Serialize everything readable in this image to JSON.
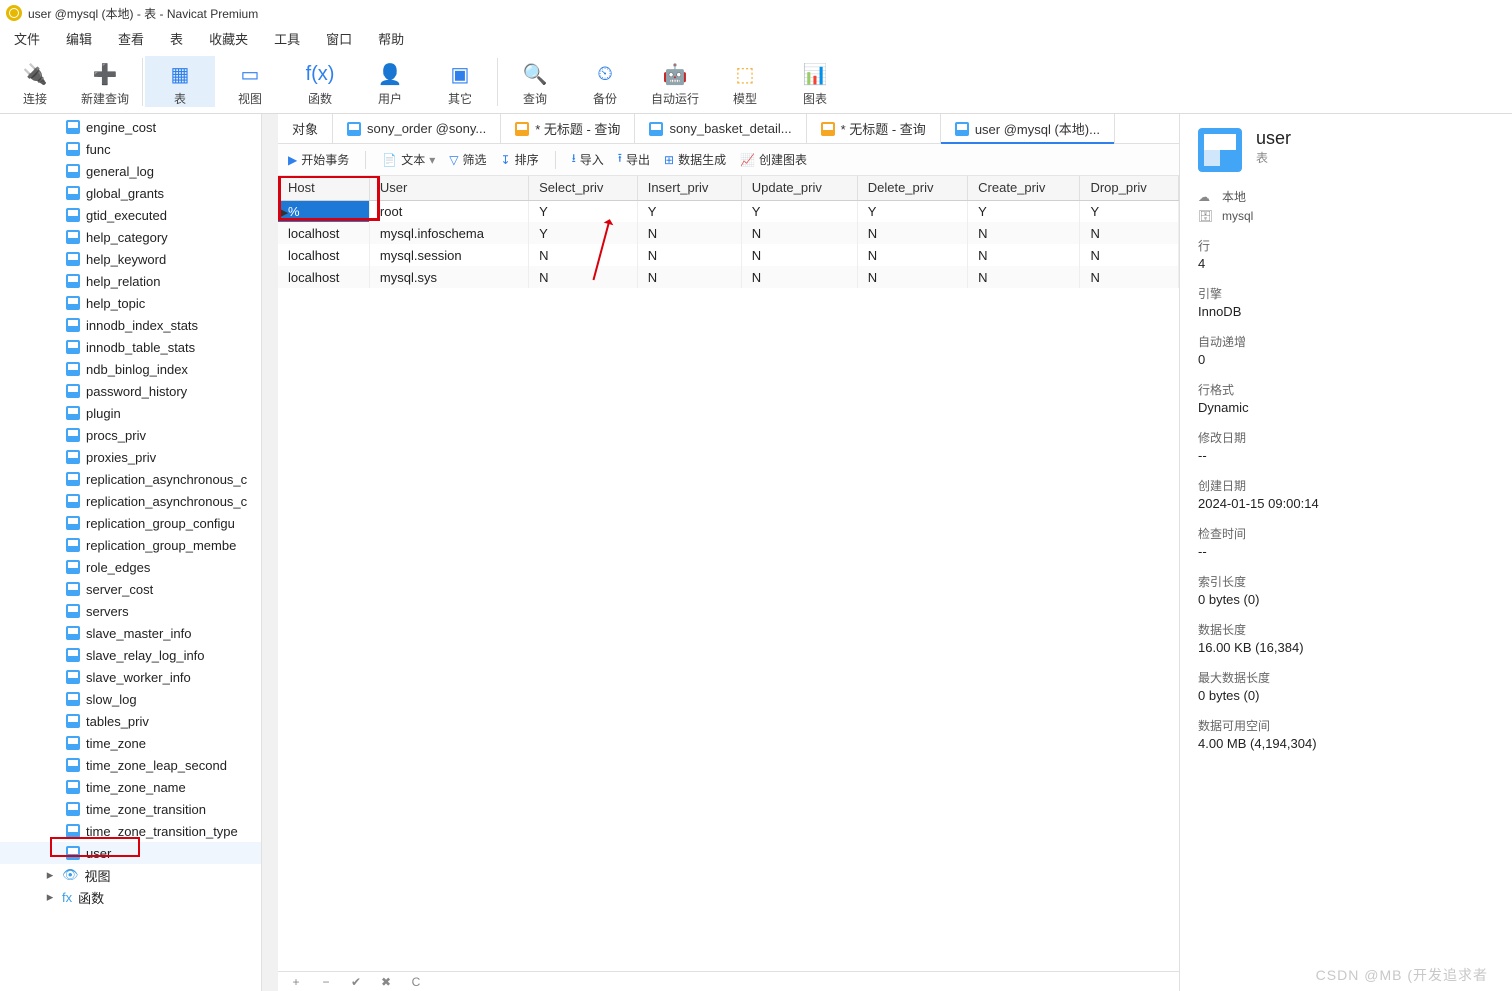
{
  "window": {
    "title": "user @mysql (本地) - 表 - Navicat Premium"
  },
  "menu": [
    "文件",
    "编辑",
    "查看",
    "表",
    "收藏夹",
    "工具",
    "窗口",
    "帮助"
  ],
  "toolbar": [
    {
      "label": "连接",
      "icon": "🔌",
      "color": "#6aa84f"
    },
    {
      "label": "新建查询",
      "icon": "➕",
      "color": "#e06666"
    },
    {
      "label": "表",
      "icon": "▦",
      "color": "#2f80ed",
      "active": true
    },
    {
      "label": "视图",
      "icon": "▭",
      "color": "#2f80ed"
    },
    {
      "label": "函数",
      "icon": "f(x)",
      "color": "#2f80ed"
    },
    {
      "label": "用户",
      "icon": "👤",
      "color": "#2f80ed"
    },
    {
      "label": "其它",
      "icon": "▣",
      "color": "#2f80ed"
    },
    {
      "label": "查询",
      "icon": "🔍",
      "color": "#2f80ed"
    },
    {
      "label": "备份",
      "icon": "⏲",
      "color": "#2f80ed"
    },
    {
      "label": "自动运行",
      "icon": "🤖",
      "color": "#2f80ed"
    },
    {
      "label": "模型",
      "icon": "⬚",
      "color": "#f5a623"
    },
    {
      "label": "图表",
      "icon": "📊",
      "color": "#7e57c2"
    }
  ],
  "tree": [
    "engine_cost",
    "func",
    "general_log",
    "global_grants",
    "gtid_executed",
    "help_category",
    "help_keyword",
    "help_relation",
    "help_topic",
    "innodb_index_stats",
    "innodb_table_stats",
    "ndb_binlog_index",
    "password_history",
    "plugin",
    "procs_priv",
    "proxies_priv",
    "replication_asynchronous_c",
    "replication_asynchronous_c",
    "replication_group_configu",
    "replication_group_membe",
    "role_edges",
    "server_cost",
    "servers",
    "slave_master_info",
    "slave_relay_log_info",
    "slave_worker_info",
    "slow_log",
    "tables_priv",
    "time_zone",
    "time_zone_leap_second",
    "time_zone_name",
    "time_zone_transition",
    "time_zone_transition_type",
    "user"
  ],
  "tree_cats": [
    {
      "label": "视图",
      "icon": "👁"
    },
    {
      "label": "函数",
      "icon": "fx"
    }
  ],
  "tabs": [
    {
      "label": "对象",
      "type": "plain"
    },
    {
      "label": "sony_order @sony...",
      "type": "table"
    },
    {
      "label": "* 无标题 - 查询",
      "type": "query"
    },
    {
      "label": "sony_basket_detail...",
      "type": "table"
    },
    {
      "label": "* 无标题 - 查询",
      "type": "query"
    },
    {
      "label": "user @mysql (本地)...",
      "type": "table",
      "active": true
    }
  ],
  "subtoolbar": {
    "begin": "开始事务",
    "text": "文本",
    "filter": "筛选",
    "sort": "排序",
    "import": "导入",
    "export": "导出",
    "gen": "数据生成",
    "chart": "创建图表"
  },
  "grid": {
    "cols": [
      "Host",
      "User",
      "Select_priv",
      "Insert_priv",
      "Update_priv",
      "Delete_priv",
      "Create_priv",
      "Drop_priv"
    ],
    "rows": [
      [
        "%",
        "root",
        "Y",
        "Y",
        "Y",
        "Y",
        "Y",
        "Y"
      ],
      [
        "localhost",
        "mysql.infoschema",
        "Y",
        "N",
        "N",
        "N",
        "N",
        "N"
      ],
      [
        "localhost",
        "mysql.session",
        "N",
        "N",
        "N",
        "N",
        "N",
        "N"
      ],
      [
        "localhost",
        "mysql.sys",
        "N",
        "N",
        "N",
        "N",
        "N",
        "N"
      ]
    ]
  },
  "info": {
    "name": "user",
    "type": "表",
    "conn": "本地",
    "db": "mysql",
    "props": [
      {
        "k": "行",
        "v": "4"
      },
      {
        "k": "引擎",
        "v": "InnoDB"
      },
      {
        "k": "自动递增",
        "v": "0"
      },
      {
        "k": "行格式",
        "v": "Dynamic"
      },
      {
        "k": "修改日期",
        "v": "--"
      },
      {
        "k": "创建日期",
        "v": "2024-01-15 09:00:14"
      },
      {
        "k": "检查时间",
        "v": "--"
      },
      {
        "k": "索引长度",
        "v": "0 bytes (0)"
      },
      {
        "k": "数据长度",
        "v": "16.00 KB (16,384)"
      },
      {
        "k": "最大数据长度",
        "v": "0 bytes (0)"
      },
      {
        "k": "数据可用空间",
        "v": "4.00 MB (4,194,304)"
      }
    ]
  },
  "watermark": "CSDN @MB (开发追求者"
}
